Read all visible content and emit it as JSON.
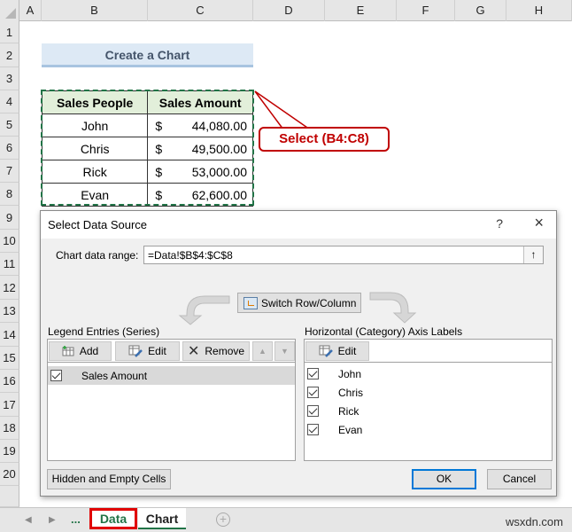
{
  "spreadsheet": {
    "columns": [
      "A",
      "B",
      "C",
      "D",
      "E",
      "F",
      "G",
      "H"
    ],
    "rows": [
      "1",
      "2",
      "3",
      "4",
      "5",
      "6",
      "7",
      "8",
      "9",
      "10",
      "11",
      "12",
      "13",
      "14",
      "15",
      "16",
      "17",
      "18",
      "19",
      "20"
    ],
    "title": "Create a Chart",
    "table": {
      "headers": [
        "Sales People",
        "Sales Amount"
      ],
      "rows": [
        {
          "name": "John",
          "currency": "$",
          "amount": "44,080.00"
        },
        {
          "name": "Chris",
          "currency": "$",
          "amount": "49,500.00"
        },
        {
          "name": "Rick",
          "currency": "$",
          "amount": "53,000.00"
        },
        {
          "name": "Evan",
          "currency": "$",
          "amount": "62,600.00"
        }
      ]
    },
    "callout": "Select (B4:C8)",
    "colors": {
      "selection": "#217346",
      "callout": "#c00000",
      "header_fill": "#e2efda",
      "title_fill": "#dde9f5"
    }
  },
  "dialog": {
    "title": "Select Data Source",
    "help": "?",
    "close": "×",
    "range_label": "Chart data range:",
    "range_value": "=Data!$B$4:$C$8",
    "collapse_icon": "↑",
    "switch_label": "Switch Row/Column",
    "legend": {
      "label": "Legend Entries (Series)",
      "add": "Add",
      "edit": "Edit",
      "remove": "Remove",
      "up": "▲",
      "down": "▼",
      "items": [
        {
          "label": "Sales Amount",
          "checked": true
        }
      ]
    },
    "axis": {
      "label": "Horizontal (Category) Axis Labels",
      "edit": "Edit",
      "items": [
        {
          "label": "John",
          "checked": true
        },
        {
          "label": "Chris",
          "checked": true
        },
        {
          "label": "Rick",
          "checked": true
        },
        {
          "label": "Evan",
          "checked": true
        }
      ]
    },
    "hidden_cells": "Hidden and Empty Cells",
    "ok": "OK",
    "cancel": "Cancel"
  },
  "sheet_tabs": {
    "prev": "◀",
    "next": "▶",
    "ellipsis": "...",
    "tabs": [
      "Data",
      "Chart"
    ],
    "active": "Data",
    "add": "+"
  },
  "watermark": "wsxdn.com"
}
